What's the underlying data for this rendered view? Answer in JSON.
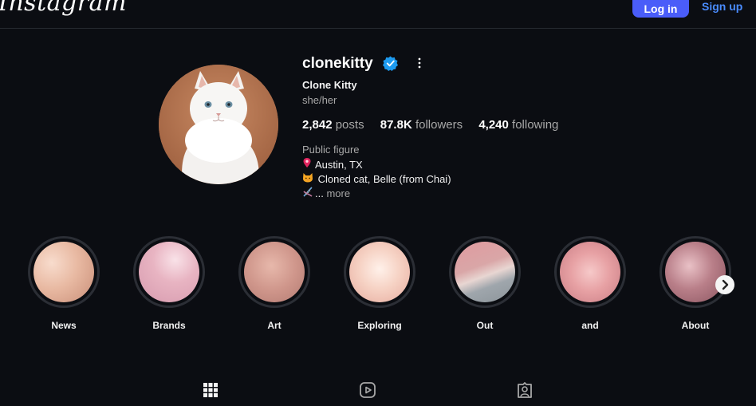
{
  "header": {
    "logo_text": "Instagram",
    "login_label": "Log in",
    "signup_label": "Sign up"
  },
  "profile": {
    "username": "clonekitty",
    "full_name": "Clone Kitty",
    "pronouns": "she/her",
    "stats": {
      "posts_count": "2,842",
      "posts_label": "posts",
      "followers_count": "87.8K",
      "followers_label": "followers",
      "following_count": "4,240",
      "following_label": "following"
    },
    "bio": {
      "category": "Public figure",
      "location": "Austin, TX",
      "line2": "Cloned cat, Belle (from Chai)",
      "line3_prefix": "...",
      "more_label": "more"
    }
  },
  "highlights": [
    {
      "label": "News"
    },
    {
      "label": "Brands"
    },
    {
      "label": "Art"
    },
    {
      "label": "Exploring"
    },
    {
      "label": "Out"
    },
    {
      "label": "and"
    },
    {
      "label": "About"
    }
  ],
  "icons": {
    "verified": "verified-badge-icon",
    "options": "more-options-icon",
    "pin": "location-pin-icon",
    "cat": "cat-face-icon",
    "dna": "dna-icon",
    "next": "chevron-right-icon",
    "posts_tab": "grid-icon",
    "reels_tab": "reels-icon",
    "tagged_tab": "tagged-icon"
  },
  "colors": {
    "background": "#0b0d12",
    "accent_button": "#4a5df9",
    "link_blue": "#4a8cff",
    "verified_blue": "#1d9bf0"
  }
}
